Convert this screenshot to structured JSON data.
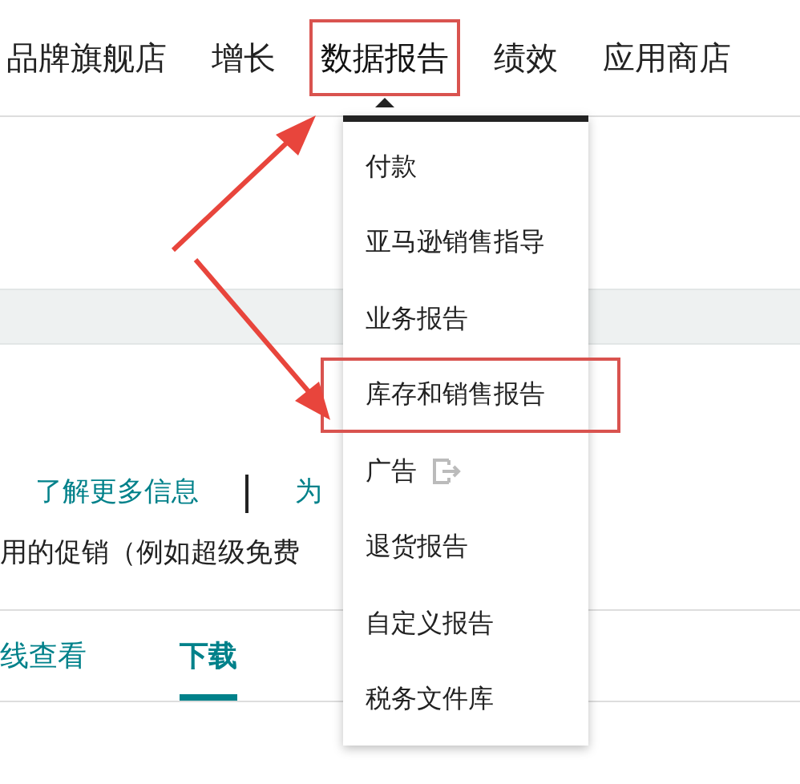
{
  "nav": [
    {
      "label": "品牌旗舰店",
      "selected": false,
      "highlighted": false
    },
    {
      "label": "增长",
      "selected": false,
      "highlighted": false
    },
    {
      "label": "数据报告",
      "selected": true,
      "highlighted": true
    },
    {
      "label": "绩效",
      "selected": false,
      "highlighted": false
    },
    {
      "label": "应用商店",
      "selected": false,
      "highlighted": false
    }
  ],
  "menu": [
    {
      "label": "付款",
      "external": false,
      "highlighted": false
    },
    {
      "label": "亚马逊销售指导",
      "external": false,
      "highlighted": false
    },
    {
      "label": "业务报告",
      "external": false,
      "highlighted": false
    },
    {
      "label": "库存和销售报告",
      "external": false,
      "highlighted": true
    },
    {
      "label": "广告",
      "external": true,
      "highlighted": false
    },
    {
      "label": "退货报告",
      "external": false,
      "highlighted": false
    },
    {
      "label": "自定义报告",
      "external": false,
      "highlighted": false
    },
    {
      "label": "税务文件库",
      "external": false,
      "highlighted": false
    }
  ],
  "links": [
    "了解更多信息",
    "为"
  ],
  "description": "用的促销（例如超级免费",
  "tabs": [
    {
      "label": "线查看",
      "selected": false
    },
    {
      "label": "下载",
      "selected": true
    }
  ]
}
